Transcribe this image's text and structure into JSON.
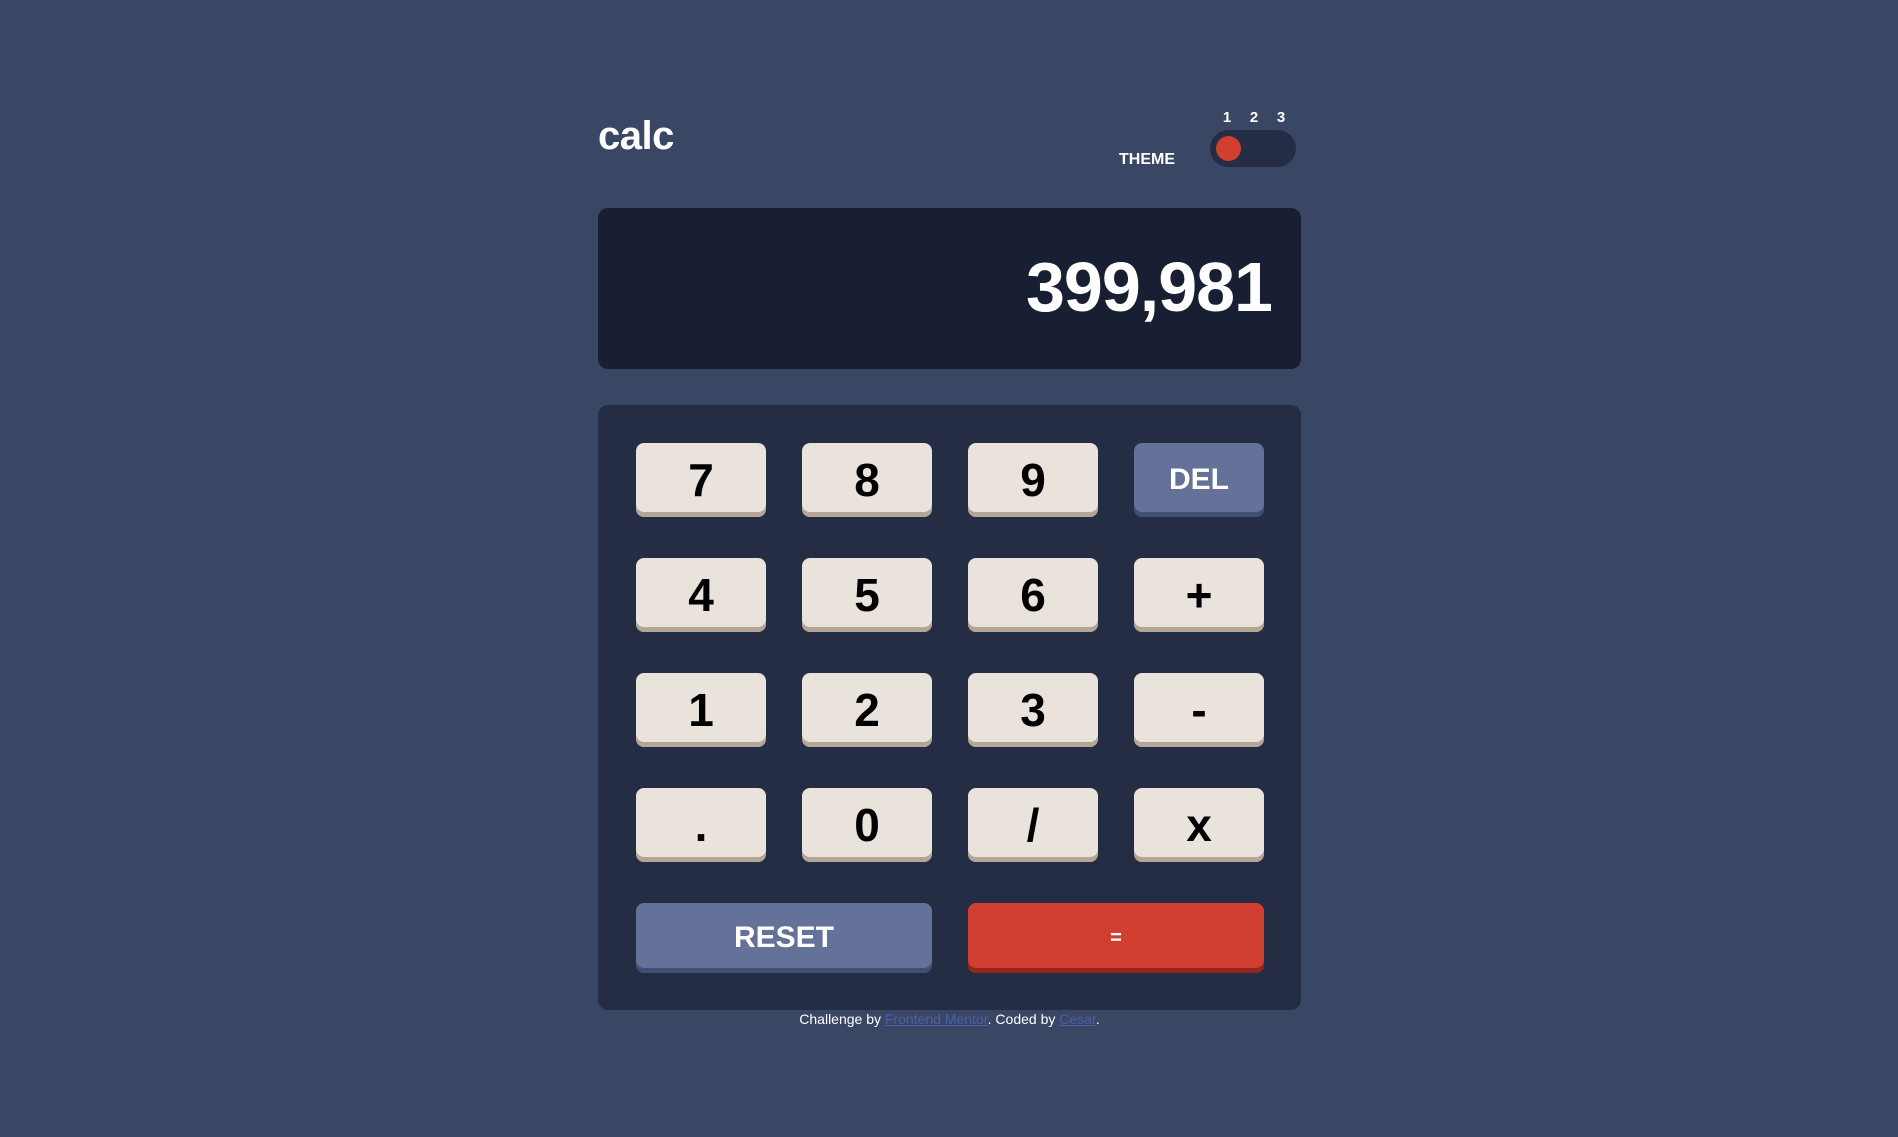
{
  "header": {
    "title": "calc",
    "theme_label": "THEME",
    "theme_options": [
      "1",
      "2",
      "3"
    ],
    "selected_theme": 1
  },
  "display": {
    "value": "399,981"
  },
  "keypad": {
    "rows": [
      [
        "7",
        "8",
        "9",
        "DEL"
      ],
      [
        "4",
        "5",
        "6",
        "+"
      ],
      [
        "1",
        "2",
        "3",
        "-"
      ],
      [
        ".",
        "0",
        "/",
        "x"
      ]
    ],
    "reset_label": "RESET",
    "equals_label": "="
  },
  "footer": {
    "prefix": "Challenge by ",
    "link1": "Frontend Mentor",
    "middle": ". Coded by ",
    "link2": "Cesar",
    "suffix": "."
  },
  "colors": {
    "background": "#3a4764",
    "display_bg": "#181f33",
    "keypad_bg": "#242d44",
    "key_bg": "#eae3dc",
    "key_shadow": "#b4a597",
    "func_key_bg": "#647198",
    "equals_bg": "#d03f2f"
  }
}
